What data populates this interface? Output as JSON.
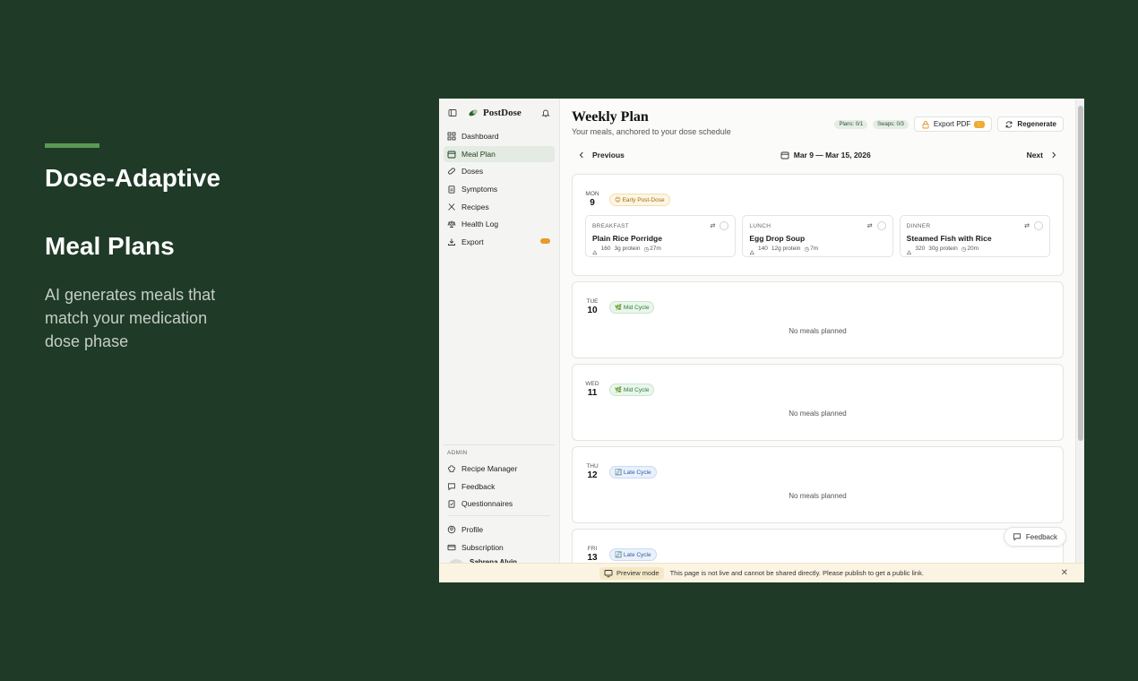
{
  "promo": {
    "title": "Dose-Adaptive",
    "subtitle": "Meal Plans",
    "description": "AI generates meals that match your medication dose phase"
  },
  "sidebar": {
    "brand": "PostDose",
    "items": [
      {
        "label": "Dashboard",
        "icon": "grid-icon"
      },
      {
        "label": "Meal Plan",
        "icon": "calendar-icon",
        "active": true
      },
      {
        "label": "Doses",
        "icon": "pill-icon"
      },
      {
        "label": "Symptoms",
        "icon": "clipboard-icon"
      },
      {
        "label": "Recipes",
        "icon": "utensils-icon"
      },
      {
        "label": "Health Log",
        "icon": "scale-icon"
      },
      {
        "label": "Export",
        "icon": "download-icon"
      }
    ],
    "admin_label": "ADMIN",
    "admin_items": [
      {
        "label": "Recipe Manager"
      },
      {
        "label": "Feedback"
      },
      {
        "label": "Questionnaires"
      }
    ],
    "account_items": [
      {
        "label": "Profile"
      },
      {
        "label": "Subscription"
      }
    ],
    "user_name": "Sabrena Alvin"
  },
  "header": {
    "title": "Weekly Plan",
    "subtitle": "Your meals, anchored to your dose schedule",
    "plans_pill": "Plans: 0/1",
    "swaps_pill": "Swaps: 0/3",
    "export_label": "Export PDF",
    "regenerate_label": "Regenerate"
  },
  "weeknav": {
    "previous": "Previous",
    "range": "Mar 9 — Mar 15, 2026",
    "next": "Next"
  },
  "days": [
    {
      "dow": "MON",
      "num": "9",
      "phase": "Early Post-Dose",
      "phase_emoji": "😊",
      "meals": [
        {
          "type": "BREAKFAST",
          "name": "Plain Rice Porridge",
          "cal": "160",
          "protein": "3g protein",
          "time": "27m"
        },
        {
          "type": "LUNCH",
          "name": "Egg Drop Soup",
          "cal": "140",
          "protein": "12g protein",
          "time": "7m"
        },
        {
          "type": "DINNER",
          "name": "Steamed Fish with Rice",
          "cal": "320",
          "protein": "30g protein",
          "time": "20m"
        }
      ]
    },
    {
      "dow": "TUE",
      "num": "10",
      "phase": "Mid Cycle",
      "phase_emoji": "🌿",
      "empty": "No meals planned"
    },
    {
      "dow": "WED",
      "num": "11",
      "phase": "Mid Cycle",
      "phase_emoji": "🌿",
      "empty": "No meals planned"
    },
    {
      "dow": "THU",
      "num": "12",
      "phase": "Late Cycle",
      "phase_emoji": "🔄",
      "empty": "No meals planned"
    },
    {
      "dow": "FRI",
      "num": "13",
      "phase": "Late Cycle",
      "phase_emoji": "🔄"
    }
  ],
  "feedback_label": "Feedback",
  "preview": {
    "tag": "Preview mode",
    "message": "This page is not live and cannot be shared directly. Please publish to get a public link."
  },
  "colors": {
    "background": "#1f3a26",
    "accent": "#5a9a55",
    "active_nav": "#e3ebe2"
  }
}
